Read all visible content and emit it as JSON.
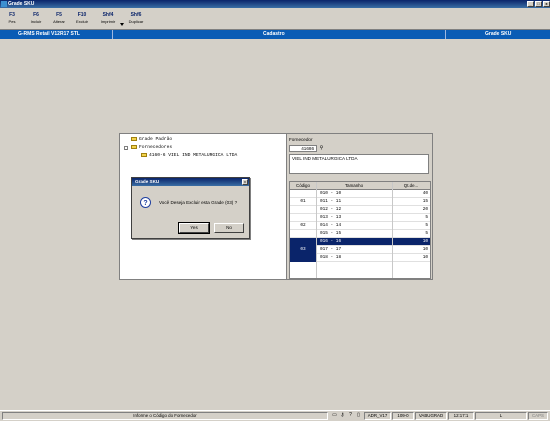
{
  "window": {
    "title": "Grade SKU"
  },
  "toolbar": {
    "buttons": [
      {
        "key": "F3",
        "label": "Pes"
      },
      {
        "key": "F6",
        "label": "Incluir"
      },
      {
        "key": "F5",
        "label": "Alterar"
      },
      {
        "key": "F10",
        "label": "Excluir"
      },
      {
        "key": "Shf4",
        "label": "Imprimir"
      },
      {
        "key": "Shf6",
        "label": "Duplicar"
      }
    ]
  },
  "header": {
    "app": "G-RMS Retail V12R17 STL",
    "center": "Cadastro",
    "right": "Grade SKU"
  },
  "tree": {
    "items": [
      {
        "label": "Grade Padrão"
      },
      {
        "label": "Fornecedores"
      },
      {
        "label": "4160-6 VIEL IND METALURGICA LTDA"
      }
    ]
  },
  "fornecedor": {
    "label": "Fornecedor",
    "code": "41686",
    "name": "VIEL IND METALURGICA LTDA"
  },
  "grid": {
    "columns": [
      "Código",
      "Tamanho",
      "Qt.de..."
    ],
    "rows": [
      {
        "group": "",
        "size": "010 - 10",
        "qty": "40"
      },
      {
        "group": "01",
        "size": "011 - 11",
        "qty": "15"
      },
      {
        "group": "",
        "size": "012 - 12",
        "qty": "20"
      },
      {
        "group": "",
        "size": "013 - 13",
        "qty": "5"
      },
      {
        "group": "02",
        "size": "014 - 14",
        "qty": "5"
      },
      {
        "group": "",
        "size": "015 - 15",
        "qty": "5"
      },
      {
        "group": "",
        "size": "016 - 16",
        "qty": "10"
      },
      {
        "group": "03",
        "size": "017 - 17",
        "qty": "10"
      },
      {
        "group": "",
        "size": "018 - 18",
        "qty": "10"
      }
    ]
  },
  "dialog": {
    "title": "Grade SKU",
    "message": "Você Deseja Excluir esta Grade (03) ?",
    "yes": "Yes",
    "no": "No"
  },
  "statusbar": {
    "hint": "Informe o Código do Fornecedor",
    "cells": [
      "ADR_V17",
      "109-0",
      "VABUGRAD",
      "12:17:1",
      "L",
      "CAPS"
    ]
  },
  "colors": {
    "accent": "#0a5cb5",
    "title": "#0a246a",
    "selection": "#0a246a"
  }
}
